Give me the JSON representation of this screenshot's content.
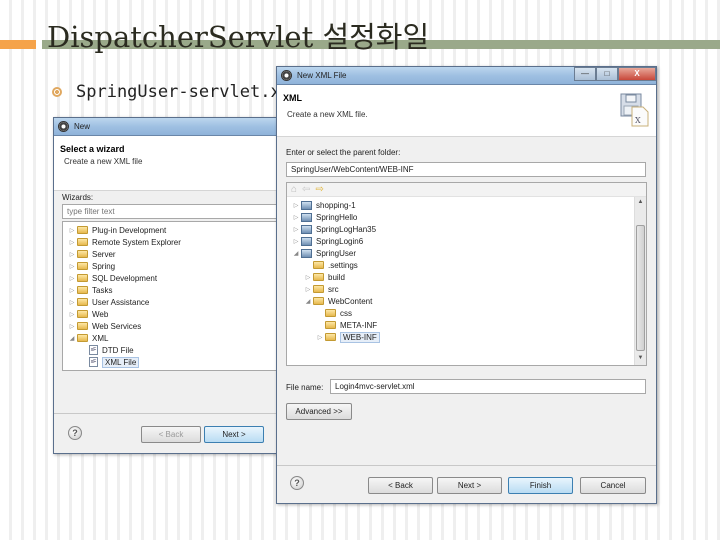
{
  "slide": {
    "title": "DispatcherServlet 설정화일",
    "bullet": "SpringUser-servlet.xml",
    "colors": {
      "orange_bar": "#f5a34a",
      "green_bar": "#9aa98a"
    }
  },
  "new_wizard_dialog": {
    "title": "New",
    "header_title": "Select a wizard",
    "header_subtitle": "Create a new XML file",
    "wizards_label": "Wizards:",
    "filter_placeholder": "type filter text",
    "tree": [
      {
        "label": "Plug-in Development",
        "icon": "folder-icon",
        "expanded": false
      },
      {
        "label": "Remote System Explorer",
        "icon": "folder-icon",
        "expanded": false
      },
      {
        "label": "Server",
        "icon": "folder-icon",
        "expanded": false
      },
      {
        "label": "Spring",
        "icon": "folder-icon",
        "expanded": false
      },
      {
        "label": "SQL Development",
        "icon": "folder-icon",
        "expanded": false
      },
      {
        "label": "Tasks",
        "icon": "folder-icon",
        "expanded": false
      },
      {
        "label": "User Assistance",
        "icon": "folder-icon",
        "expanded": false
      },
      {
        "label": "Web",
        "icon": "folder-icon",
        "expanded": false
      },
      {
        "label": "Web Services",
        "icon": "folder-icon",
        "expanded": false
      },
      {
        "label": "XML",
        "icon": "folder-icon",
        "expanded": true
      },
      {
        "label": "DTD File",
        "icon": "file-icon",
        "child": true
      },
      {
        "label": "XML File",
        "icon": "file-icon",
        "child": true,
        "selected": true
      }
    ],
    "buttons": {
      "back": "< Back",
      "next": "Next >"
    },
    "help": "?"
  },
  "new_xml_dialog": {
    "title": "New XML File",
    "window_buttons": {
      "minimize": "—",
      "maximize": "□",
      "close": "X"
    },
    "header_title": "XML",
    "header_subtitle": "Create a new XML file.",
    "parent_folder_label": "Enter or select the parent folder:",
    "parent_folder_value": "SpringUser/WebContent/WEB-INF",
    "nav_icons": [
      "home-icon",
      "back-arrow-icon",
      "forward-arrow-icon"
    ],
    "tree": [
      {
        "label": "shopping-1",
        "level": 0,
        "icon": "project-icon",
        "twisty": "collapsed"
      },
      {
        "label": "SpringHello",
        "level": 0,
        "icon": "project-icon",
        "twisty": "collapsed"
      },
      {
        "label": "SpringLogHan35",
        "level": 0,
        "icon": "project-icon",
        "twisty": "collapsed"
      },
      {
        "label": "SpringLogin6",
        "level": 0,
        "icon": "project-icon",
        "twisty": "collapsed"
      },
      {
        "label": "SpringUser",
        "level": 0,
        "icon": "project-icon",
        "twisty": "expanded"
      },
      {
        "label": ".settings",
        "level": 1,
        "icon": "folder-icon",
        "twisty": "none"
      },
      {
        "label": "build",
        "level": 1,
        "icon": "folder-icon",
        "twisty": "collapsed"
      },
      {
        "label": "src",
        "level": 1,
        "icon": "folder-icon",
        "twisty": "collapsed"
      },
      {
        "label": "WebContent",
        "level": 1,
        "icon": "folder-icon",
        "twisty": "expanded"
      },
      {
        "label": "css",
        "level": 2,
        "icon": "folder-icon",
        "twisty": "none"
      },
      {
        "label": "META-INF",
        "level": 2,
        "icon": "folder-icon",
        "twisty": "none"
      },
      {
        "label": "WEB-INF",
        "level": 2,
        "icon": "folder-icon",
        "twisty": "collapsed",
        "selected": true
      }
    ],
    "file_name_label": "File name:",
    "file_name_value": "Login4mvc-servlet.xml",
    "advanced_button": "Advanced >>",
    "buttons": {
      "back": "< Back",
      "next": "Next >",
      "finish": "Finish",
      "cancel": "Cancel"
    },
    "help": "?"
  }
}
